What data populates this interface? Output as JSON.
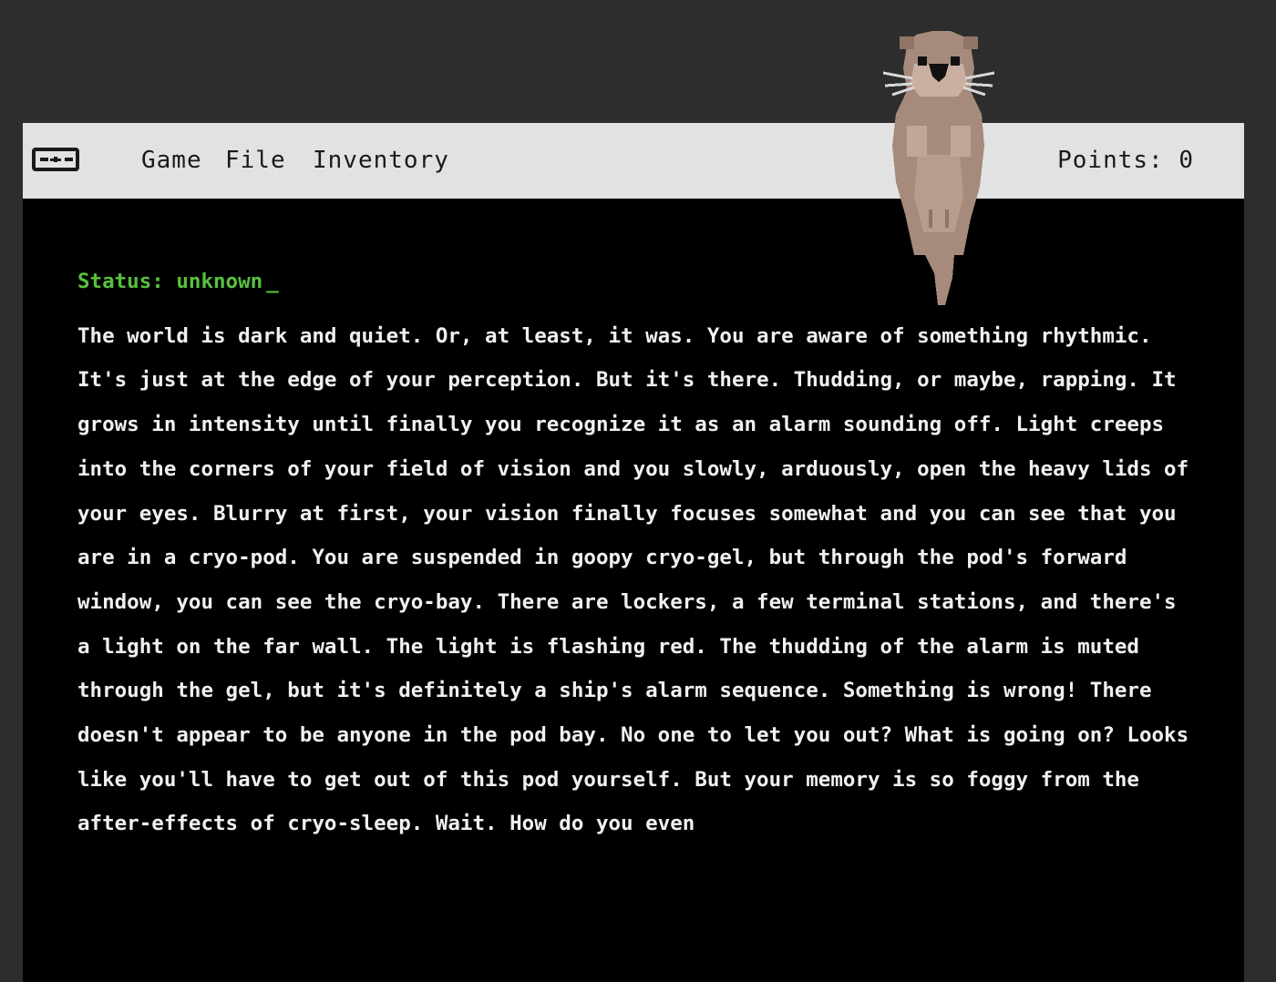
{
  "menubar": {
    "logo_icon": "game-controller-icon",
    "items": [
      "Game",
      "File",
      "Inventory"
    ],
    "points_label": "Points: 0"
  },
  "terminal": {
    "status": "Status: unknown",
    "cursor": "_",
    "story": "The world is dark and quiet. Or, at least, it was. You are aware of something rhythmic. It's just at the edge of your perception. But it's there. Thudding, or maybe, rapping. It grows in intensity until finally you recognize it as an alarm sounding off. Light creeps into the corners of your field of vision and you slowly, arduously, open the heavy lids of your eyes. Blurry at first, your vision finally focuses somewhat and you can see that you are in a cryo-pod. You are suspended in goopy cryo-gel, but through the pod's forward window, you can see the cryo-bay. There are lockers, a few terminal stations, and there's a light on the far wall. The light is flashing red. The thudding of the alarm is muted through the gel, but it's definitely a ship's alarm sequence. Something is wrong! There doesn't appear to be anyone in the pod bay. No one to let you out? What is going on? Looks like you'll have to get out of this pod yourself. But your memory is so foggy from the after-effects of cryo-sleep. Wait. How do you even"
  },
  "mascot": {
    "icon": "otter-icon"
  },
  "colors": {
    "background": "#2d2d2d",
    "menubar": "#e2e2e2",
    "terminal_bg": "#000000",
    "terminal_text": "#f0f0f0",
    "status_text": "#58c13c",
    "otter_fur": "#a68a7b"
  }
}
